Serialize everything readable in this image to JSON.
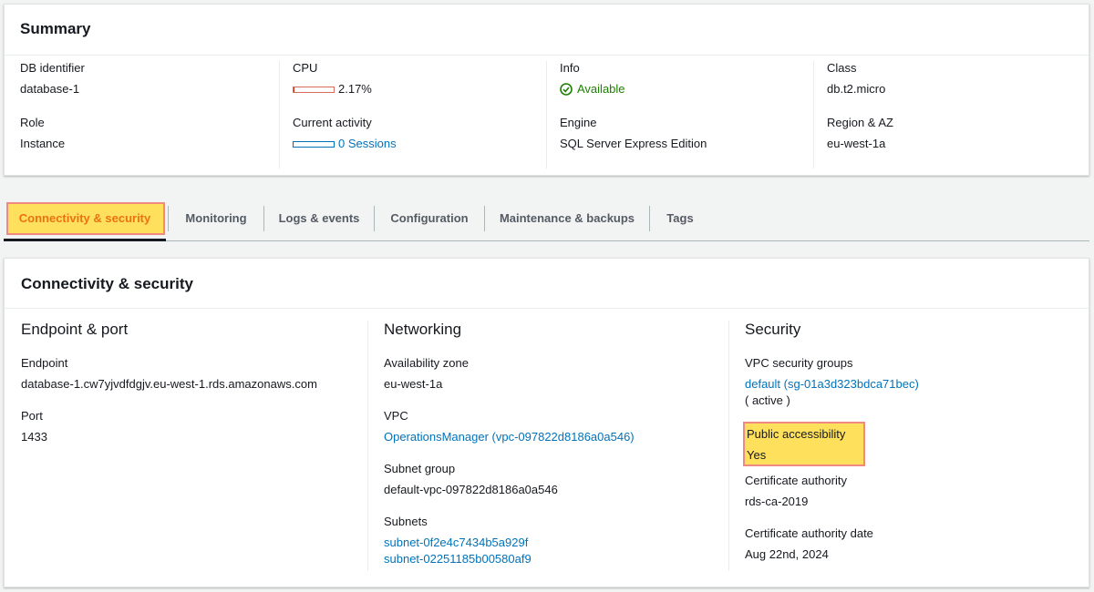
{
  "summary": {
    "title": "Summary",
    "db_identifier_label": "DB identifier",
    "db_identifier": "database-1",
    "role_label": "Role",
    "role": "Instance",
    "cpu_label": "CPU",
    "cpu_value": "2.17%",
    "cpu_fraction": 0.0217,
    "activity_label": "Current activity",
    "activity_value": "0 Sessions",
    "info_label": "Info",
    "info_value": "Available",
    "engine_label": "Engine",
    "engine_value": "SQL Server Express Edition",
    "class_label": "Class",
    "class_value": "db.t2.micro",
    "region_label": "Region & AZ",
    "region_value": "eu-west-1a"
  },
  "tabs": [
    {
      "label": "Connectivity & security",
      "active": true
    },
    {
      "label": "Monitoring"
    },
    {
      "label": "Logs & events"
    },
    {
      "label": "Configuration"
    },
    {
      "label": "Maintenance & backups"
    },
    {
      "label": "Tags"
    }
  ],
  "connectivity": {
    "title": "Connectivity & security",
    "endpoint_section": {
      "title": "Endpoint & port",
      "endpoint_label": "Endpoint",
      "endpoint_value": "database-1.cw7yjvdfdgjv.eu-west-1.rds.amazonaws.com",
      "port_label": "Port",
      "port_value": "1433"
    },
    "networking_section": {
      "title": "Networking",
      "az_label": "Availability zone",
      "az_value": "eu-west-1a",
      "vpc_label": "VPC",
      "vpc_value": "OperationsManager (vpc-097822d8186a0a546)",
      "subnet_group_label": "Subnet group",
      "subnet_group_value": "default-vpc-097822d8186a0a546",
      "subnets_label": "Subnets",
      "subnets": [
        "subnet-0f2e4c7434b5a929f",
        "subnet-02251185b00580af9"
      ]
    },
    "security_section": {
      "title": "Security",
      "sg_label": "VPC security groups",
      "sg_value": "default (sg-01a3d323bdca71bec)",
      "sg_status": "( active )",
      "public_label": "Public accessibility",
      "public_value": "Yes",
      "ca_label": "Certificate authority",
      "ca_value": "rds-ca-2019",
      "ca_date_label": "Certificate authority date",
      "ca_date_value": "Aug 22nd, 2024"
    }
  },
  "colors": {
    "link": "#0073bb",
    "success": "#1d8102",
    "active_tab": "#ec7211",
    "highlight": "#ffe05c",
    "highlight_border": "#f08a80"
  }
}
